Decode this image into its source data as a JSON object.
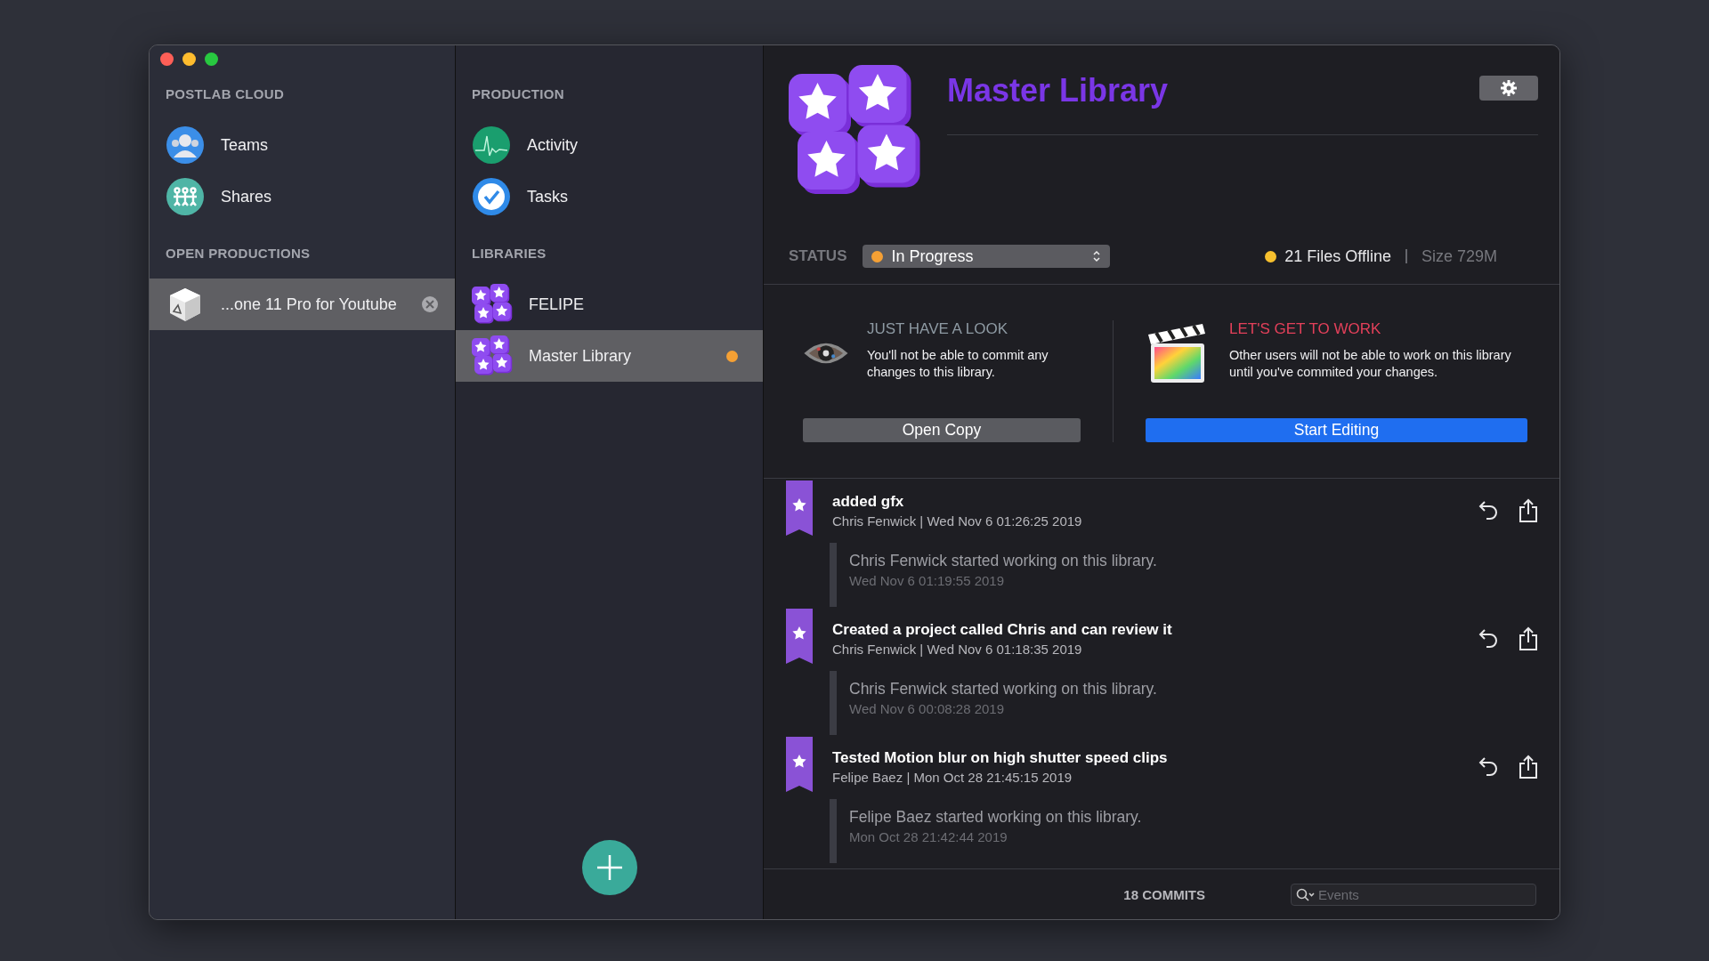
{
  "sidebar": {
    "sections": [
      {
        "heading": "POSTLAB CLOUD",
        "items": [
          {
            "label": "Teams",
            "kind": "teams",
            "selected": false
          },
          {
            "label": "Shares",
            "kind": "shares",
            "selected": false
          }
        ]
      },
      {
        "heading": "OPEN PRODUCTIONS",
        "items": [
          {
            "label": "...one 11 Pro for Youtube",
            "kind": "production",
            "selected": true,
            "closable": true
          }
        ]
      }
    ]
  },
  "production_column": {
    "sections": [
      {
        "heading": "PRODUCTION",
        "items": [
          {
            "label": "Activity",
            "kind": "activity",
            "selected": false
          },
          {
            "label": "Tasks",
            "kind": "tasks",
            "selected": false
          }
        ]
      },
      {
        "heading": "LIBRARIES",
        "items": [
          {
            "label": "FELIPE",
            "kind": "library",
            "selected": false,
            "modified": false
          },
          {
            "label": "Master Library",
            "kind": "library",
            "selected": true,
            "modified": true
          }
        ]
      }
    ]
  },
  "library": {
    "title": "Master Library",
    "status_label": "STATUS",
    "status_value": "In Progress",
    "files_offline": "21 Files Offline",
    "size": "Size 729M"
  },
  "actions": [
    {
      "kind": "look",
      "title": "JUST HAVE A LOOK",
      "text": "You'll not be able to commit any changes to this library.",
      "button": "Open Copy"
    },
    {
      "kind": "edit",
      "title": "LET'S GET TO WORK",
      "text": "Other users will not be able to work on this library until you've commited your changes.",
      "button": "Start Editing"
    }
  ],
  "events": [
    {
      "kind": "commit",
      "title": "added gfx",
      "meta": "Chris Fenwick | Wed Nov 6 01:26:25 2019"
    },
    {
      "kind": "note",
      "title": "Chris Fenwick started working on this library.",
      "meta": "Wed Nov 6 01:19:55 2019"
    },
    {
      "kind": "commit",
      "title": "Created a project called Chris and can review it",
      "meta": "Chris Fenwick | Wed Nov 6 01:18:35 2019"
    },
    {
      "kind": "note",
      "title": "Chris Fenwick started working on this library.",
      "meta": "Wed Nov 6 00:08:28 2019"
    },
    {
      "kind": "commit",
      "title": "Tested Motion blur on high shutter speed clips",
      "meta": "Felipe Baez | Mon Oct 28 21:45:15 2019"
    },
    {
      "kind": "note",
      "title": "Felipe Baez started working on this library.",
      "meta": "Mon Oct 28 21:42:44 2019"
    }
  ],
  "footer": {
    "commits": "18 COMMITS",
    "search": {
      "placeholder": "Events"
    }
  }
}
